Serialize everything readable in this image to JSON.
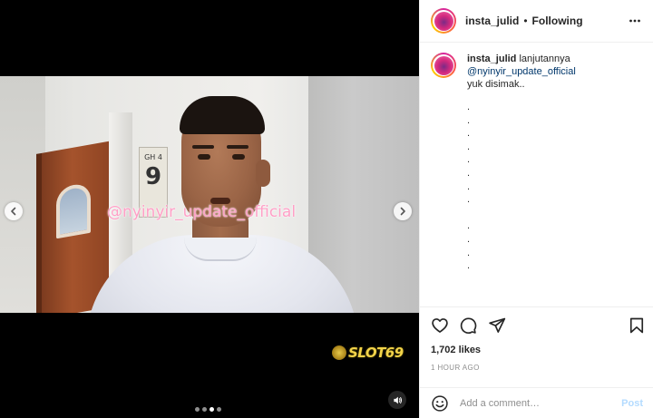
{
  "media": {
    "watermark": "@nyinyir_update_official",
    "room_sign_small": "GH 4",
    "room_sign_big": "9",
    "brand_logo": "SLOT69",
    "carousel": {
      "count": 4,
      "active_index": 2
    },
    "icons": {
      "prev": "chevron-left-icon",
      "next": "chevron-right-icon",
      "audio": "speaker-icon"
    }
  },
  "header": {
    "username": "insta_julid",
    "separator": "•",
    "follow_status": "Following"
  },
  "caption": {
    "username": "insta_julid",
    "text": "lanjutannya",
    "mention": "@nyinyir_update_official",
    "line2": "yuk disimak..",
    "dots": [
      ".",
      ".",
      ".",
      ".",
      ".",
      ".",
      ".",
      ".",
      "",
      ".",
      ".",
      ".",
      "."
    ]
  },
  "actions": {
    "icons": [
      "heart-icon",
      "comment-icon",
      "share-icon",
      "bookmark-icon"
    ]
  },
  "stats": {
    "likes": "1,702 likes",
    "time": "1 HOUR AGO"
  },
  "comment_box": {
    "placeholder": "Add a comment…",
    "post_label": "Post",
    "post_color": "#b3dbff"
  },
  "colors": {
    "mention": "#00376b",
    "text": "#262626",
    "muted": "#8e8e8e",
    "watermark": "#ff9fc6",
    "logo": "#f2d34a"
  }
}
